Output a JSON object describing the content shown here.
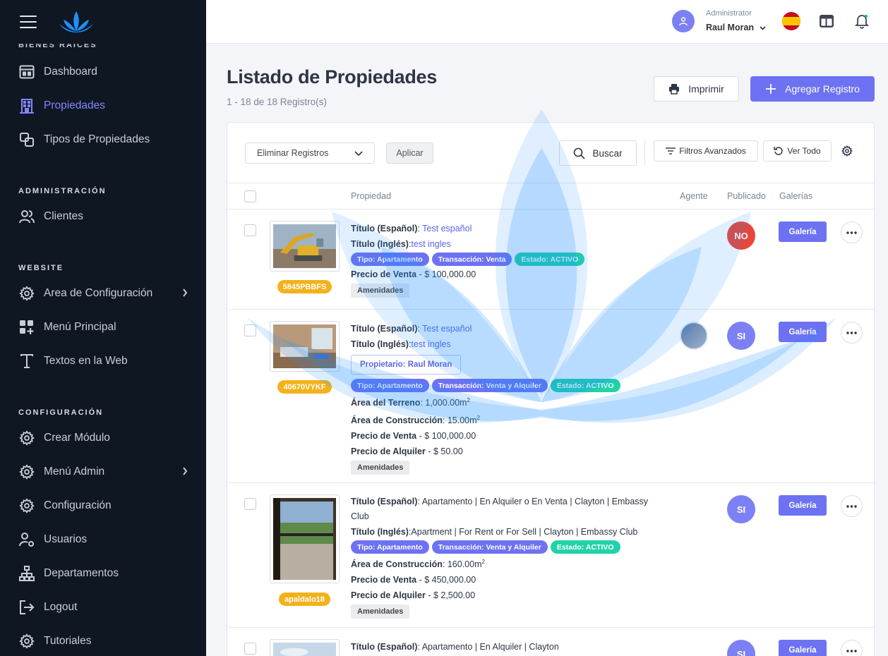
{
  "sidebar": {
    "cut_section": "BIENES RAICES",
    "group1": [
      {
        "label": "Dashboard",
        "icon": "dashboard-icon"
      },
      {
        "label": "Propiedades",
        "icon": "building-icon",
        "active": true
      },
      {
        "label": "Tipos de Propiedades",
        "icon": "copy-icon"
      }
    ],
    "section_admin": "ADMINISTRACIÓN",
    "admin": [
      {
        "label": "Clientes",
        "icon": "users-icon"
      }
    ],
    "section_website": "WEBSITE",
    "website": [
      {
        "label": "Area de Configuración",
        "icon": "gear-icon"
      },
      {
        "label": "Menú Principal",
        "icon": "grid-plus-icon"
      },
      {
        "label": "Textos en la Web",
        "icon": "text-icon"
      }
    ],
    "section_config": "CONFIGURACIÓN",
    "config": [
      {
        "label": "Crear Módulo",
        "icon": "gear-icon"
      },
      {
        "label": "Menú Admin",
        "icon": "gear-icon"
      },
      {
        "label": "Configuración",
        "icon": "gear-icon"
      },
      {
        "label": "Usuarios",
        "icon": "user-gear-icon"
      },
      {
        "label": "Departamentos",
        "icon": "sitemap-icon"
      },
      {
        "label": "Logout",
        "icon": "logout-icon"
      },
      {
        "label": "Tutoriales",
        "icon": "gear-icon"
      }
    ]
  },
  "topbar": {
    "role": "Administrator",
    "user": "Raul Moran"
  },
  "header": {
    "title": "Listado de Propiedades",
    "subtitle": "1 - 18 de 18 Registro(s)",
    "print": "Imprimir",
    "add": "Agregar Registro"
  },
  "toolbar": {
    "bulk": "Eliminar Registros",
    "apply": "Aplicar",
    "search": "Buscar",
    "filters": "Filtros Avanzados",
    "view_all": "Ver Todo"
  },
  "table": {
    "col_property": "Propiedad",
    "col_agent": "Agente",
    "col_published": "Publicado",
    "col_galleries": "Galerías"
  },
  "labels": {
    "title_es": "Título (Español)",
    "title_en": "Título (Inglés)",
    "sale_price": "Precio de Venta",
    "rent_price": "Precio de Alquiler",
    "land_area": "Área del Terreno",
    "build_area": "Área de Construcción",
    "amenities": "Amenidades",
    "gallery": "Galería"
  },
  "rows": [
    {
      "code": "5845PBBFS",
      "title_es": "Test español",
      "title_en": "test ingles",
      "tag_type": "Tipo: Apartamento",
      "tag_trans": "Transacción: Venta",
      "tag_state": "Estado: ACTIVO",
      "sale": "$ 100,000.00",
      "published": "NO"
    },
    {
      "code": "40670VYKF",
      "title_es": "Test español",
      "title_en": "test ingles",
      "owner": "Propietario: Raul Moran",
      "tag_type": "Tipo: Apartamento",
      "tag_trans": "Transacción: Venta y Alquiler",
      "tag_state": "Estado: ACTIVO",
      "land": "1,000.00m",
      "build": "15.00m",
      "sale": "$ 100,000.00",
      "rent": "$ 50.00",
      "published": "SI"
    },
    {
      "code": "apaldalo18",
      "title_es": "Apartamento | En Alquiler o En Venta | Clayton | Embassy Club",
      "title_en": "Apartment | For Rent or For Sell | Clayton | Embassy Club",
      "tag_type": "Tipo: Apartamento",
      "tag_trans": "Transacción: Venta y Alquiler",
      "tag_state": "Estado: ACTIVO",
      "build": "160.00m",
      "sale": "$ 450,000.00",
      "rent": "$ 2,500.00",
      "published": "SI"
    },
    {
      "title_es": "Apartamento | En Alquiler | Clayton",
      "published": "SI"
    }
  ],
  "colors": {
    "accent": "#6d72f2",
    "sidebar_bg": "#0f1722",
    "danger": "#e8463b",
    "success": "#22d3a7",
    "code_badge": "#f3b21b"
  }
}
